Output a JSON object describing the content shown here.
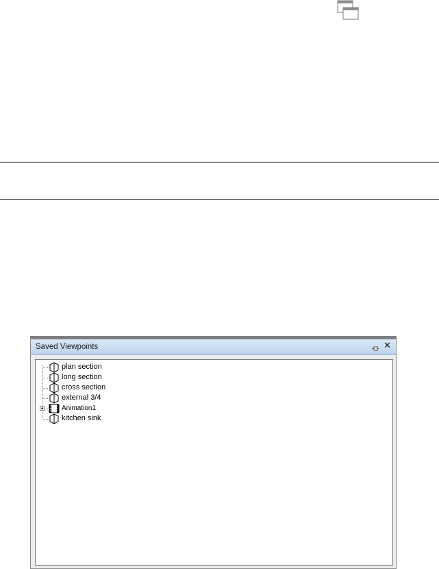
{
  "panel": {
    "title": "Saved Viewpoints",
    "pin_icon": "pin-icon",
    "close_label": "✕"
  },
  "tree": {
    "items": [
      {
        "label": "plan section",
        "icon": "viewpoint-icon"
      },
      {
        "label": "long section",
        "icon": "viewpoint-icon"
      },
      {
        "label": "cross section",
        "icon": "viewpoint-icon"
      },
      {
        "label": "external 3/4",
        "icon": "viewpoint-icon"
      },
      {
        "label": "Animation1",
        "icon": "animation-film-icon",
        "expandable": true
      },
      {
        "label": "kitchen sink",
        "icon": "viewpoint-icon"
      }
    ]
  }
}
